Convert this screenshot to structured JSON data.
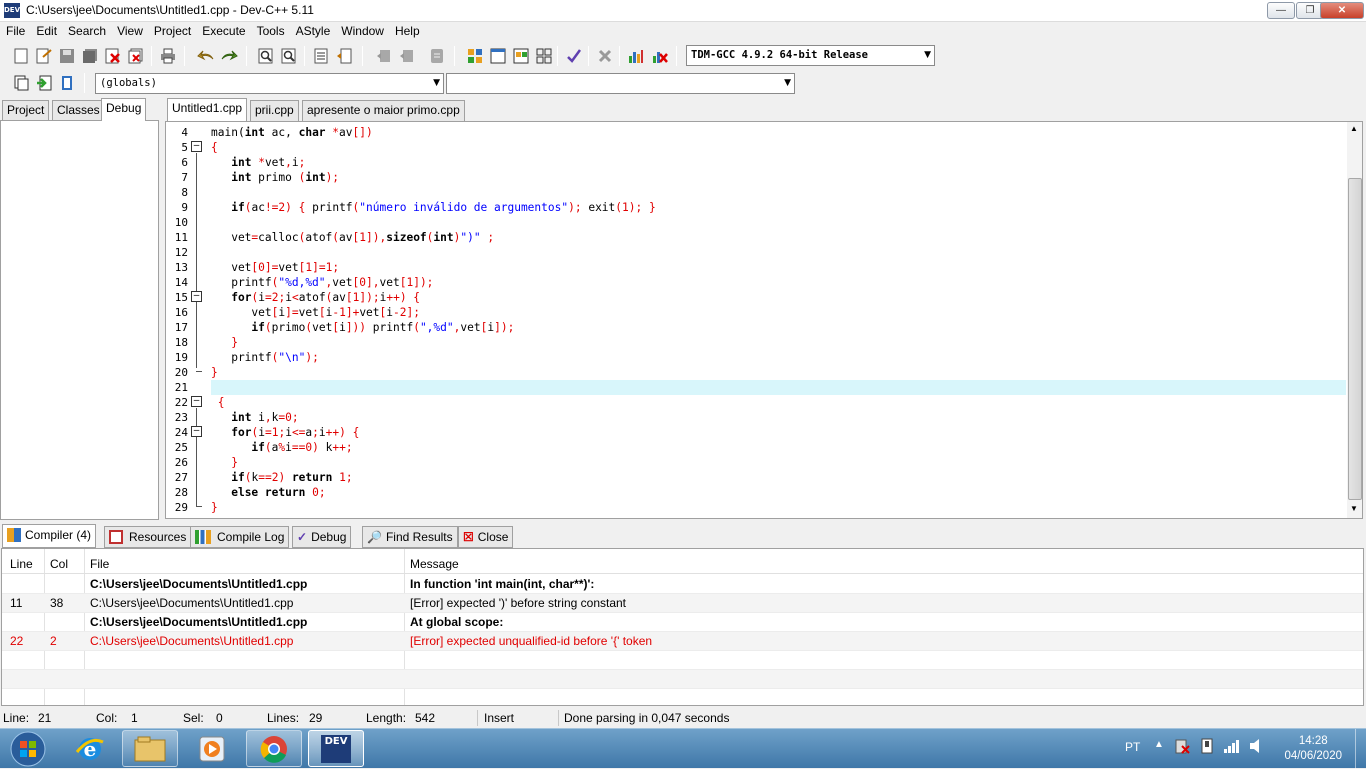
{
  "window": {
    "title": "C:\\Users\\jee\\Documents\\Untitled1.cpp - Dev-C++ 5.11",
    "app_icon": "DEV"
  },
  "menu": [
    "File",
    "Edit",
    "Search",
    "View",
    "Project",
    "Execute",
    "Tools",
    "AStyle",
    "Window",
    "Help"
  ],
  "toolbar": {
    "compiler": "TDM-GCC 4.9.2 64-bit Release",
    "scope": "(globals)",
    "symbol": ""
  },
  "left_tabs": [
    "Project",
    "Classes",
    "Debug"
  ],
  "editor_tabs": [
    "Untitled1.cpp",
    "prii.cpp",
    "apresente o maior primo.cpp"
  ],
  "code_lines": [
    {
      "n": "4",
      "html": "main(<span class='kw'>int</span> ac, <span class='kw'>char</span> <span class='sym'>*</span>av<span class='sym'>[])</span>"
    },
    {
      "n": "5",
      "html": "<span class='sym'>{</span>"
    },
    {
      "n": "6",
      "html": "   <span class='kw'>int</span> <span class='sym'>*</span>vet<span class='sym'>,</span>i<span class='sym'>;</span>"
    },
    {
      "n": "7",
      "html": "   <span class='kw'>int</span> primo <span class='sym'>(</span><span class='kw'>int</span><span class='sym'>);</span>"
    },
    {
      "n": "8",
      "html": ""
    },
    {
      "n": "9",
      "html": "   <span class='kw'>if</span><span class='sym'>(</span>ac<span class='sym'>!=</span><span class='num'>2</span><span class='sym'>) {</span> printf<span class='sym'>(</span><span class='str'>\"número inválido de argumentos\"</span><span class='sym'>);</span> exit<span class='sym'>(</span><span class='num'>1</span><span class='sym'>); }</span>"
    },
    {
      "n": "10",
      "html": ""
    },
    {
      "n": "11",
      "html": "   vet<span class='sym'>=</span>calloc<span class='sym'>(</span>atof<span class='sym'>(</span>av<span class='sym'>[</span><span class='num'>1</span><span class='sym'>]),</span><span class='kw'>sizeof</span><span class='sym'>(</span><span class='kw'>int</span><span class='sym'>)</span><span class='str'>\")\"</span> <span class='sym'>;</span>"
    },
    {
      "n": "12",
      "html": ""
    },
    {
      "n": "13",
      "html": "   vet<span class='sym'>[</span><span class='num'>0</span><span class='sym'>]=</span>vet<span class='sym'>[</span><span class='num'>1</span><span class='sym'>]=</span><span class='num'>1</span><span class='sym'>;</span>"
    },
    {
      "n": "14",
      "html": "   printf<span class='sym'>(</span><span class='str'>\"%d,%d\"</span><span class='sym'>,</span>vet<span class='sym'>[</span><span class='num'>0</span><span class='sym'>],</span>vet<span class='sym'>[</span><span class='num'>1</span><span class='sym'>]);</span>"
    },
    {
      "n": "15",
      "html": "   <span class='kw'>for</span><span class='sym'>(</span>i<span class='sym'>=</span><span class='num'>2</span><span class='sym'>;</span>i<span class='sym'>&lt;</span>atof<span class='sym'>(</span>av<span class='sym'>[</span><span class='num'>1</span><span class='sym'>]);</span>i<span class='sym'>++) {</span>"
    },
    {
      "n": "16",
      "html": "      vet<span class='sym'>[</span>i<span class='sym'>]=</span>vet<span class='sym'>[</span>i<span class='sym'>-</span><span class='num'>1</span><span class='sym'>]+</span>vet<span class='sym'>[</span>i<span class='sym'>-</span><span class='num'>2</span><span class='sym'>];</span>"
    },
    {
      "n": "17",
      "html": "      <span class='kw'>if</span><span class='sym'>(</span>primo<span class='sym'>(</span>vet<span class='sym'>[</span>i<span class='sym'>]))</span> printf<span class='sym'>(</span><span class='str'>\",%d\"</span><span class='sym'>,</span>vet<span class='sym'>[</span>i<span class='sym'>]);</span>"
    },
    {
      "n": "18",
      "html": "   <span class='sym'>}</span>"
    },
    {
      "n": "19",
      "html": "   printf<span class='sym'>(</span><span class='str'>\"\\n\"</span><span class='sym'>);</span>"
    },
    {
      "n": "20",
      "html": "<span class='sym'>}</span>"
    },
    {
      "n": "21",
      "html": ""
    },
    {
      "n": "22",
      "html": " <span class='sym'>{</span>"
    },
    {
      "n": "23",
      "html": "   <span class='kw'>int</span> i<span class='sym'>,</span>k<span class='sym'>=</span><span class='num'>0</span><span class='sym'>;</span>"
    },
    {
      "n": "24",
      "html": "   <span class='kw'>for</span><span class='sym'>(</span>i<span class='sym'>=</span><span class='num'>1</span><span class='sym'>;</span>i<span class='sym'>&lt;=</span>a<span class='sym'>;</span>i<span class='sym'>++) {</span>"
    },
    {
      "n": "25",
      "html": "      <span class='kw'>if</span><span class='sym'>(</span>a<span class='sym'>%</span>i<span class='sym'>==</span><span class='num'>0</span><span class='sym'>)</span> k<span class='sym'>++;</span>"
    },
    {
      "n": "26",
      "html": "   <span class='sym'>}</span>"
    },
    {
      "n": "27",
      "html": "   <span class='kw'>if</span><span class='sym'>(</span>k<span class='sym'>==</span><span class='num'>2</span><span class='sym'>)</span> <span class='kw'>return</span> <span class='num'>1</span><span class='sym'>;</span>"
    },
    {
      "n": "28",
      "html": "   <span class='kw'>else</span> <span class='kw'>return</span> <span class='num'>0</span><span class='sym'>;</span>"
    },
    {
      "n": "29",
      "html": "<span class='sym'>}</span>"
    }
  ],
  "bottom_tabs": [
    "Compiler (4)",
    "Resources",
    "Compile Log",
    "Debug",
    "Find Results",
    "Close"
  ],
  "messages": {
    "headers": [
      "Line",
      "Col",
      "File",
      "Message"
    ],
    "rows": [
      {
        "line": "",
        "col": "",
        "file": "C:\\Users\\jee\\Documents\\Untitled1.cpp",
        "msg": "In function 'int main(int, char**)':",
        "style": "bold"
      },
      {
        "line": "11",
        "col": "38",
        "file": "C:\\Users\\jee\\Documents\\Untitled1.cpp",
        "msg": "[Error] expected ')' before string constant",
        "style": "normal"
      },
      {
        "line": "",
        "col": "",
        "file": "C:\\Users\\jee\\Documents\\Untitled1.cpp",
        "msg": "At global scope:",
        "style": "bold"
      },
      {
        "line": "22",
        "col": "2",
        "file": "C:\\Users\\jee\\Documents\\Untitled1.cpp",
        "msg": "[Error] expected unqualified-id before '{' token",
        "style": "error"
      }
    ]
  },
  "status": {
    "line_label": "Line:",
    "line": "21",
    "col_label": "Col:",
    "col": "1",
    "sel_label": "Sel:",
    "sel": "0",
    "lines_label": "Lines:",
    "lines": "29",
    "length_label": "Length:",
    "length": "542",
    "mode": "Insert",
    "message": "Done parsing in 0,047 seconds"
  },
  "taskbar": {
    "lang": "PT",
    "time": "14:28",
    "date": "04/06/2020",
    "devcpp_icon": "DEV"
  },
  "colors": {
    "keyword": "#000000",
    "symbol": "#e00000",
    "string": "#0000ff",
    "current_line": "#d8f6fb",
    "error_text": "#e00000",
    "taskbar": "#4a82b4"
  }
}
